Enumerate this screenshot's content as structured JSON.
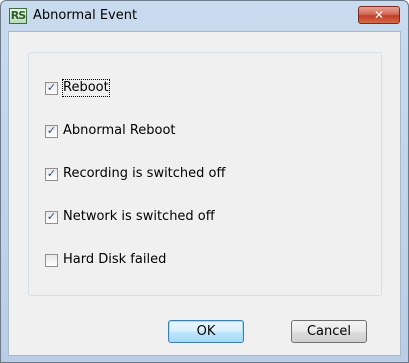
{
  "window": {
    "title": "Abnormal Event",
    "app_icon_text": "RS",
    "close_glyph": "✕"
  },
  "options": [
    {
      "label": "Reboot",
      "checked": true,
      "focused": true
    },
    {
      "label": "Abnormal Reboot",
      "checked": true,
      "focused": false
    },
    {
      "label": "Recording is switched off",
      "checked": true,
      "focused": false
    },
    {
      "label": "Network is switched off",
      "checked": true,
      "focused": false
    },
    {
      "label": "Hard Disk failed",
      "checked": false,
      "focused": false
    }
  ],
  "buttons": {
    "ok_label": "OK",
    "cancel_label": "Cancel"
  },
  "icons": {
    "app": "app-logo-icon",
    "close": "close-icon",
    "check": "checkmark-icon"
  },
  "colors": {
    "title_bar": "#c9dbef",
    "close_button": "#c94a34",
    "dialog_background": "#f0f0f0",
    "default_button_border": "#3c7fb1"
  }
}
